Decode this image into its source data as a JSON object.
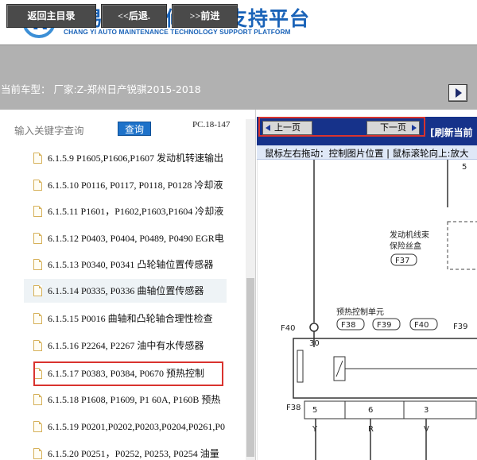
{
  "header": {
    "title": "畅易汽车维修技术支持平台",
    "subtitle": "CHANG YI AUTO MAINTENANCE TECHNOLOGY SUPPORT PLATFORM"
  },
  "nav": {
    "home": "返回主目录",
    "back": "<<后退.",
    "forward": ">>前进"
  },
  "vehicle": {
    "label": "当前车型：  厂家:Z-郑州日产锐骐2015-2018"
  },
  "search": {
    "label": "输入关键字查询",
    "button": "查询",
    "page_code": "PC.18-147"
  },
  "tree": {
    "items": [
      {
        "label": "6.1.5.9 P1605,P1606,P1607 发动机转速输出"
      },
      {
        "label": "6.1.5.10 P0116, P0117, P0118, P0128 冷却液"
      },
      {
        "label": "6.1.5.11 P1601，P1602,P1603,P1604 冷却液"
      },
      {
        "label": "6.1.5.12 P0403, P0404, P0489, P0490 EGR电"
      },
      {
        "label": "6.1.5.13 P0340, P0341 凸轮轴位置传感器"
      },
      {
        "label": "6.1.5.14 P0335, P0336 曲轴位置传感器"
      },
      {
        "label": "6.1.5.15 P0016 曲轴和凸轮轴合理性检查"
      },
      {
        "label": "6.1.5.16 P2264, P2267 油中有水传感器"
      },
      {
        "label": "6.1.5.17 P0383, P0384, P0670 预热控制"
      },
      {
        "label": "6.1.5.18 P1608, P1609, P1 60A, P160B 预热"
      },
      {
        "label": "6.1.5.19 P0201,P0202,P0203,P0204,P0261,P0"
      },
      {
        "label": "6.1.5.20 P0251，P0252, P0253, P0254 油量"
      }
    ]
  },
  "viewer": {
    "prev_page": "上一页",
    "next_page": "下一页",
    "refresh": "[刷新当前",
    "hint": "鼠标左右拖动：控制图片位置 | 鼠标滚轮向上:放大"
  },
  "diagram": {
    "harness_label": "发动机线束",
    "harness_label2": "保险丝盒",
    "f37": "F37",
    "f40_top": "F40",
    "f40_mid": "F40",
    "f38": "F38",
    "f39": "F39",
    "f39b": "F39",
    "f38b": "F38",
    "num30": "30",
    "glow_label": "预热控制单元",
    "col5": "5",
    "col6": "6",
    "col3": "3",
    "y": "Y",
    "r": "R",
    "v": "V",
    "five_top": "5"
  }
}
